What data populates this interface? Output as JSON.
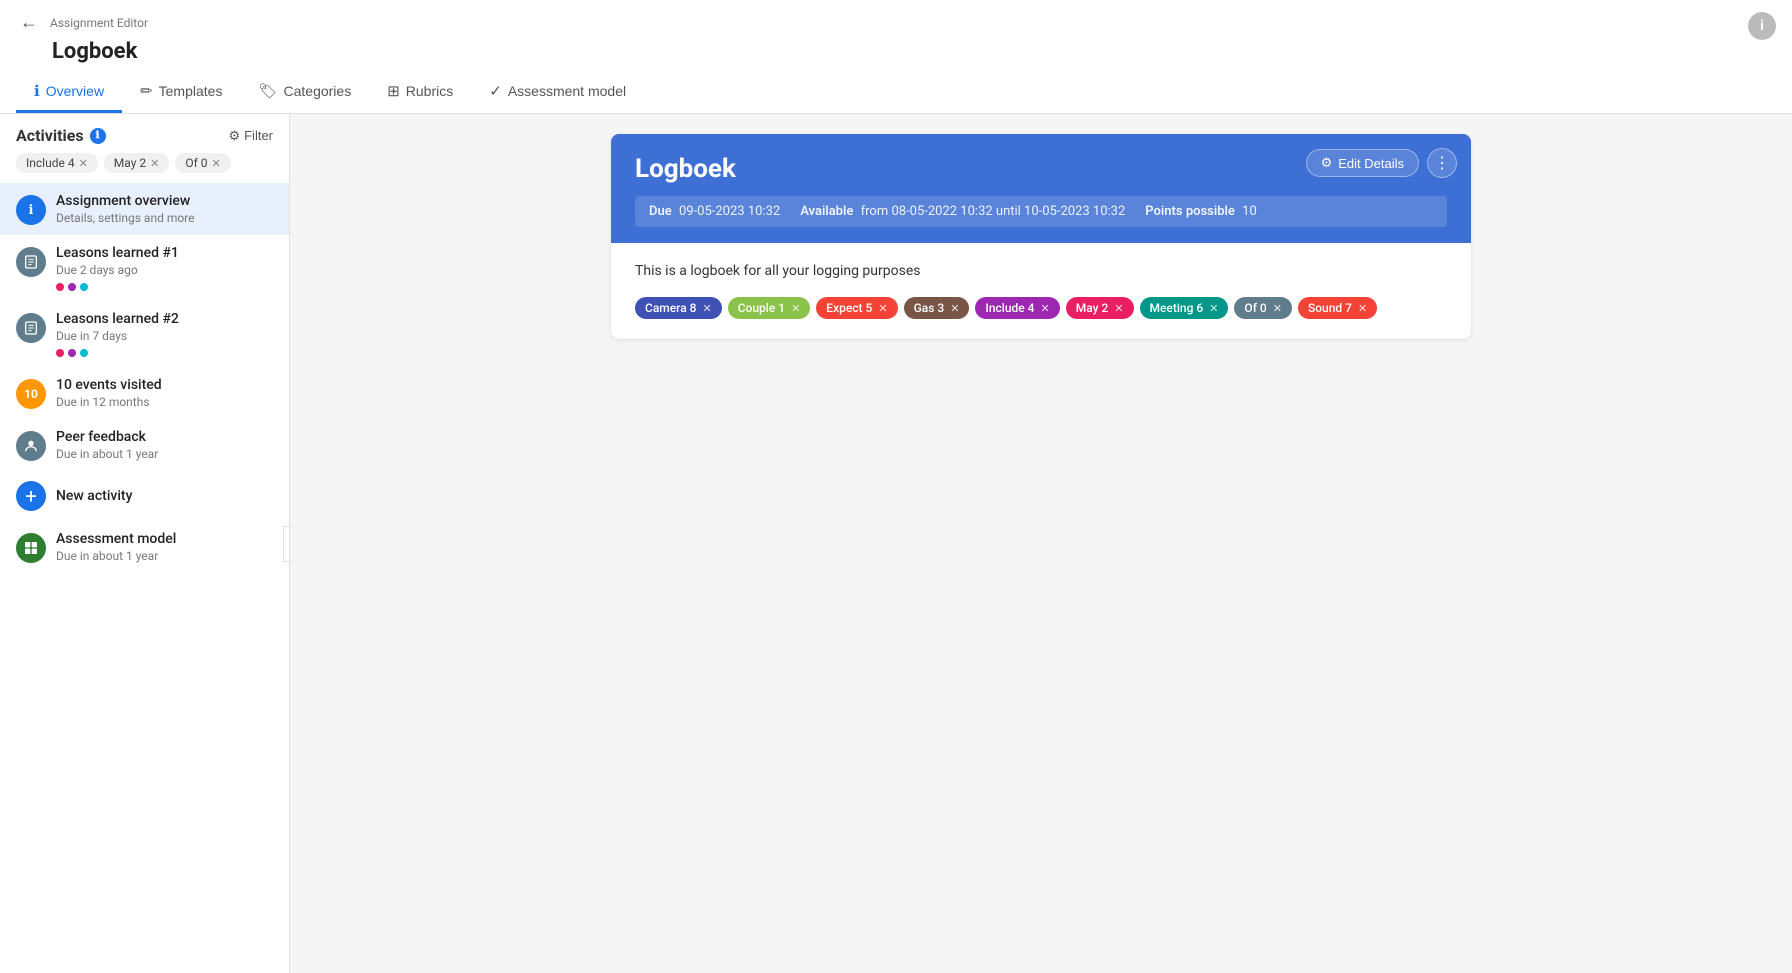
{
  "app": {
    "breadcrumb": "Assignment Editor",
    "title": "Logboek",
    "info_icon": "i"
  },
  "tabs": [
    {
      "id": "overview",
      "label": "Overview",
      "icon": "ℹ",
      "active": true
    },
    {
      "id": "templates",
      "label": "Templates",
      "icon": "✏",
      "active": false
    },
    {
      "id": "categories",
      "label": "Categories",
      "icon": "🏷",
      "active": false
    },
    {
      "id": "rubrics",
      "label": "Rubrics",
      "icon": "⊞",
      "active": false
    },
    {
      "id": "assessment",
      "label": "Assessment model",
      "icon": "✓",
      "active": false
    }
  ],
  "sidebar": {
    "title": "Activities",
    "filter_label": "Filter",
    "filter_tags": [
      {
        "label": "Include 4"
      },
      {
        "label": "May 2"
      },
      {
        "label": "Of 0"
      }
    ]
  },
  "activities": [
    {
      "id": "assignment-overview",
      "name": "Assignment overview",
      "sub": "Details, settings and more",
      "icon_bg": "#1a73e8",
      "icon_text": "ℹ",
      "active": true,
      "dots": []
    },
    {
      "id": "leasons-learned-1",
      "name": "Leasons learned #1",
      "sub": "Due 2 days ago",
      "icon_bg": "#666",
      "icon_text": "📋",
      "active": false,
      "dots": [
        "#e91e63",
        "#9c27b0",
        "#00bcd4"
      ]
    },
    {
      "id": "leasons-learned-2",
      "name": "Leasons learned #2",
      "sub": "Due in 7 days",
      "icon_bg": "#666",
      "icon_text": "📋",
      "active": false,
      "dots": [
        "#e91e63",
        "#9c27b0",
        "#00bcd4"
      ]
    },
    {
      "id": "10-events-visited",
      "name": "10 events visited",
      "sub": "Due in 12 months",
      "icon_bg": "#ff9800",
      "icon_text": "10",
      "active": false,
      "dots": []
    },
    {
      "id": "peer-feedback",
      "name": "Peer feedback",
      "sub": "Due in about 1 year",
      "icon_bg": "#555",
      "icon_text": "👤",
      "active": false,
      "dots": []
    },
    {
      "id": "assessment-model",
      "name": "Assessment model",
      "sub": "Due in about 1 year",
      "icon_bg": "#2e7d32",
      "icon_text": "⊞",
      "active": false,
      "dots": []
    }
  ],
  "new_activity_label": "New activity",
  "card": {
    "title": "Logboek",
    "edit_details_label": "Edit Details",
    "due_label": "Due",
    "due_value": "09-05-2023 10:32",
    "available_label": "Available",
    "available_value": "from 08-05-2022 10:32 until 10-05-2023 10:32",
    "points_label": "Points possible",
    "points_value": "10",
    "description": "This is a logboek for all your logging purposes",
    "tags": [
      {
        "label": "Camera 8",
        "color": "#3f51b5"
      },
      {
        "label": "Couple 1",
        "color": "#8bc34a"
      },
      {
        "label": "Expect 5",
        "color": "#f44336"
      },
      {
        "label": "Gas 3",
        "color": "#795548"
      },
      {
        "label": "Include 4",
        "color": "#9c27b0"
      },
      {
        "label": "May 2",
        "color": "#e91e63"
      },
      {
        "label": "Meeting 6",
        "color": "#009688"
      },
      {
        "label": "Of 0",
        "color": "#607d8b"
      },
      {
        "label": "Sound 7",
        "color": "#f44336"
      }
    ]
  }
}
